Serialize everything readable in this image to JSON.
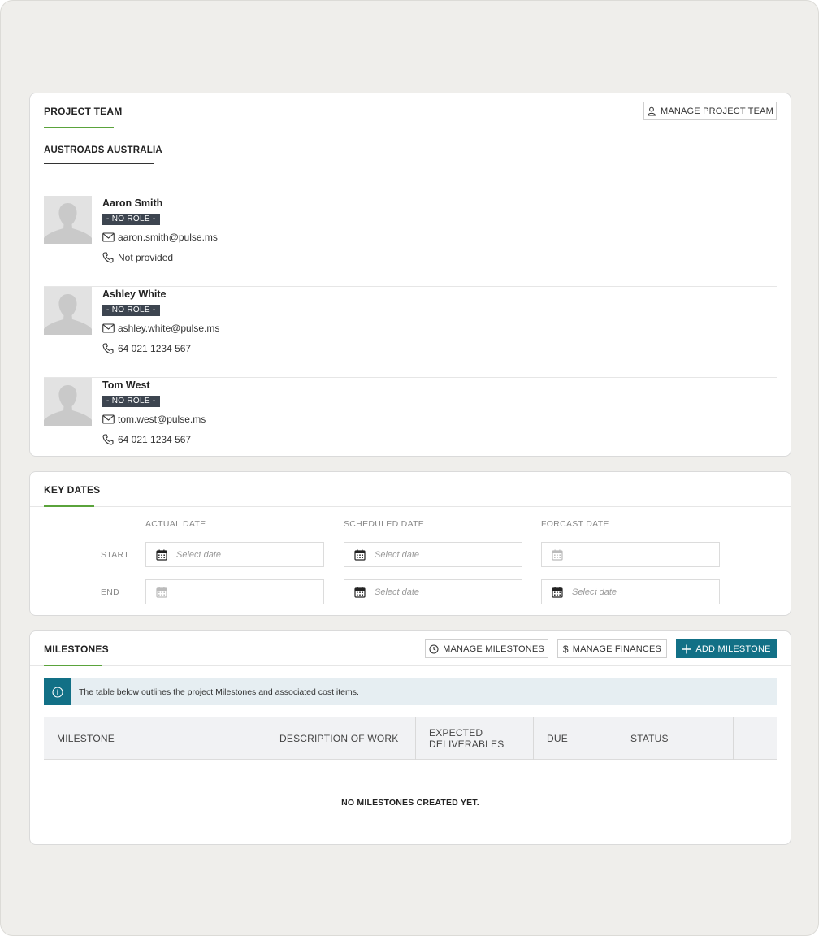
{
  "project_team": {
    "title": "PROJECT TEAM",
    "manage_button": "MANAGE PROJECT TEAM",
    "organisation": "AUSTROADS AUSTRALIA",
    "members": [
      {
        "name": "Aaron Smith",
        "role": "- NO ROLE -",
        "email": "aaron.smith@pulse.ms",
        "phone": "Not provided"
      },
      {
        "name": "Ashley White",
        "role": "- NO ROLE -",
        "email": "ashley.white@pulse.ms",
        "phone": "64 021 1234 567"
      },
      {
        "name": "Tom West",
        "role": "- NO ROLE -",
        "email": "tom.west@pulse.ms",
        "phone": "64 021 1234 567"
      }
    ]
  },
  "key_dates": {
    "title": "KEY DATES",
    "columns": [
      "ACTUAL DATE",
      "SCHEDULED DATE",
      "FORCAST DATE"
    ],
    "rows": [
      {
        "label": "START",
        "placeholders": [
          "Select date",
          "Select date",
          ""
        ]
      },
      {
        "label": "END",
        "placeholders": [
          "",
          "Select date",
          "Select date"
        ]
      }
    ]
  },
  "milestones": {
    "title": "MILESTONES",
    "manage_milestones_button": "MANAGE MILESTONES",
    "manage_finances_button": "MANAGE FINANCES",
    "add_button": "ADD MILESTONE",
    "info_text": "The table below outlines the project Milestones and associated cost items.",
    "columns": [
      "MILESTONE",
      "DESCRIPTION OF WORK",
      "EXPECTED DELIVERABLES",
      "DUE",
      "STATUS",
      ""
    ],
    "empty_message": "NO MILESTONES CREATED YET."
  },
  "colors": {
    "accent_green": "#5aa33b",
    "primary_teal": "#127086",
    "badge_dark": "#3d4550"
  }
}
